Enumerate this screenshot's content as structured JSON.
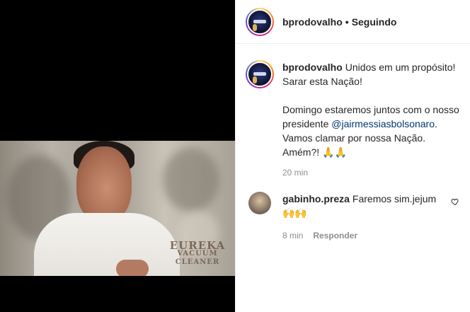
{
  "header": {
    "username": "bprodovalho",
    "separator": "•",
    "follow_status": "Seguindo"
  },
  "caption": {
    "username": "bprodovalho",
    "line1": "Unidos em um propósito! Sarar esta Nação!",
    "line2_before": "Domingo estaremos juntos com o nosso presidente",
    "mention": "@jairmessiasbolsonaro",
    "line2_after": ". Vamos clamar por nossa Nação. Amém?! 🙏🙏",
    "time": "20 min"
  },
  "comment": {
    "username": "gabinho.preza",
    "text": "Faremos sim.jejum 🙌🙌",
    "time": "8 min",
    "reply_label": "Responder"
  },
  "video_overlay": {
    "sign_line1": "EUREKA",
    "sign_line2": "VACUUM",
    "sign_line3": "CLEANER"
  }
}
